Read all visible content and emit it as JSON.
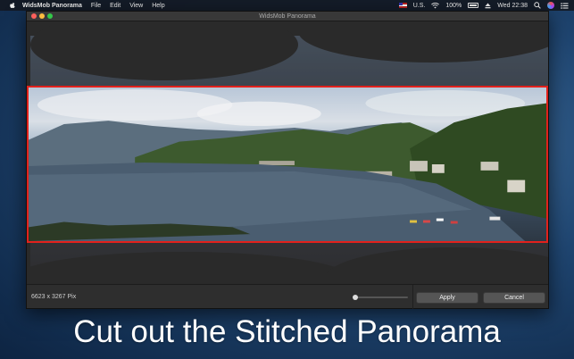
{
  "menubar": {
    "app_name": "WidsMob Panorama",
    "menus": [
      "File",
      "Edit",
      "View",
      "Help"
    ],
    "input_source": "U.S.",
    "battery": "100%",
    "clock": "Wed 22:38"
  },
  "window": {
    "title": "WidsMob Panorama"
  },
  "status": {
    "dimensions": "6623 x 3267 Pix"
  },
  "zoom": {
    "value": 0.02
  },
  "buttons": {
    "apply": "Apply",
    "cancel": "Cancel"
  },
  "caption": "Cut out the Stitched Panorama",
  "colors": {
    "crop_border": "#e2211c",
    "desktop": "#1f4570"
  }
}
